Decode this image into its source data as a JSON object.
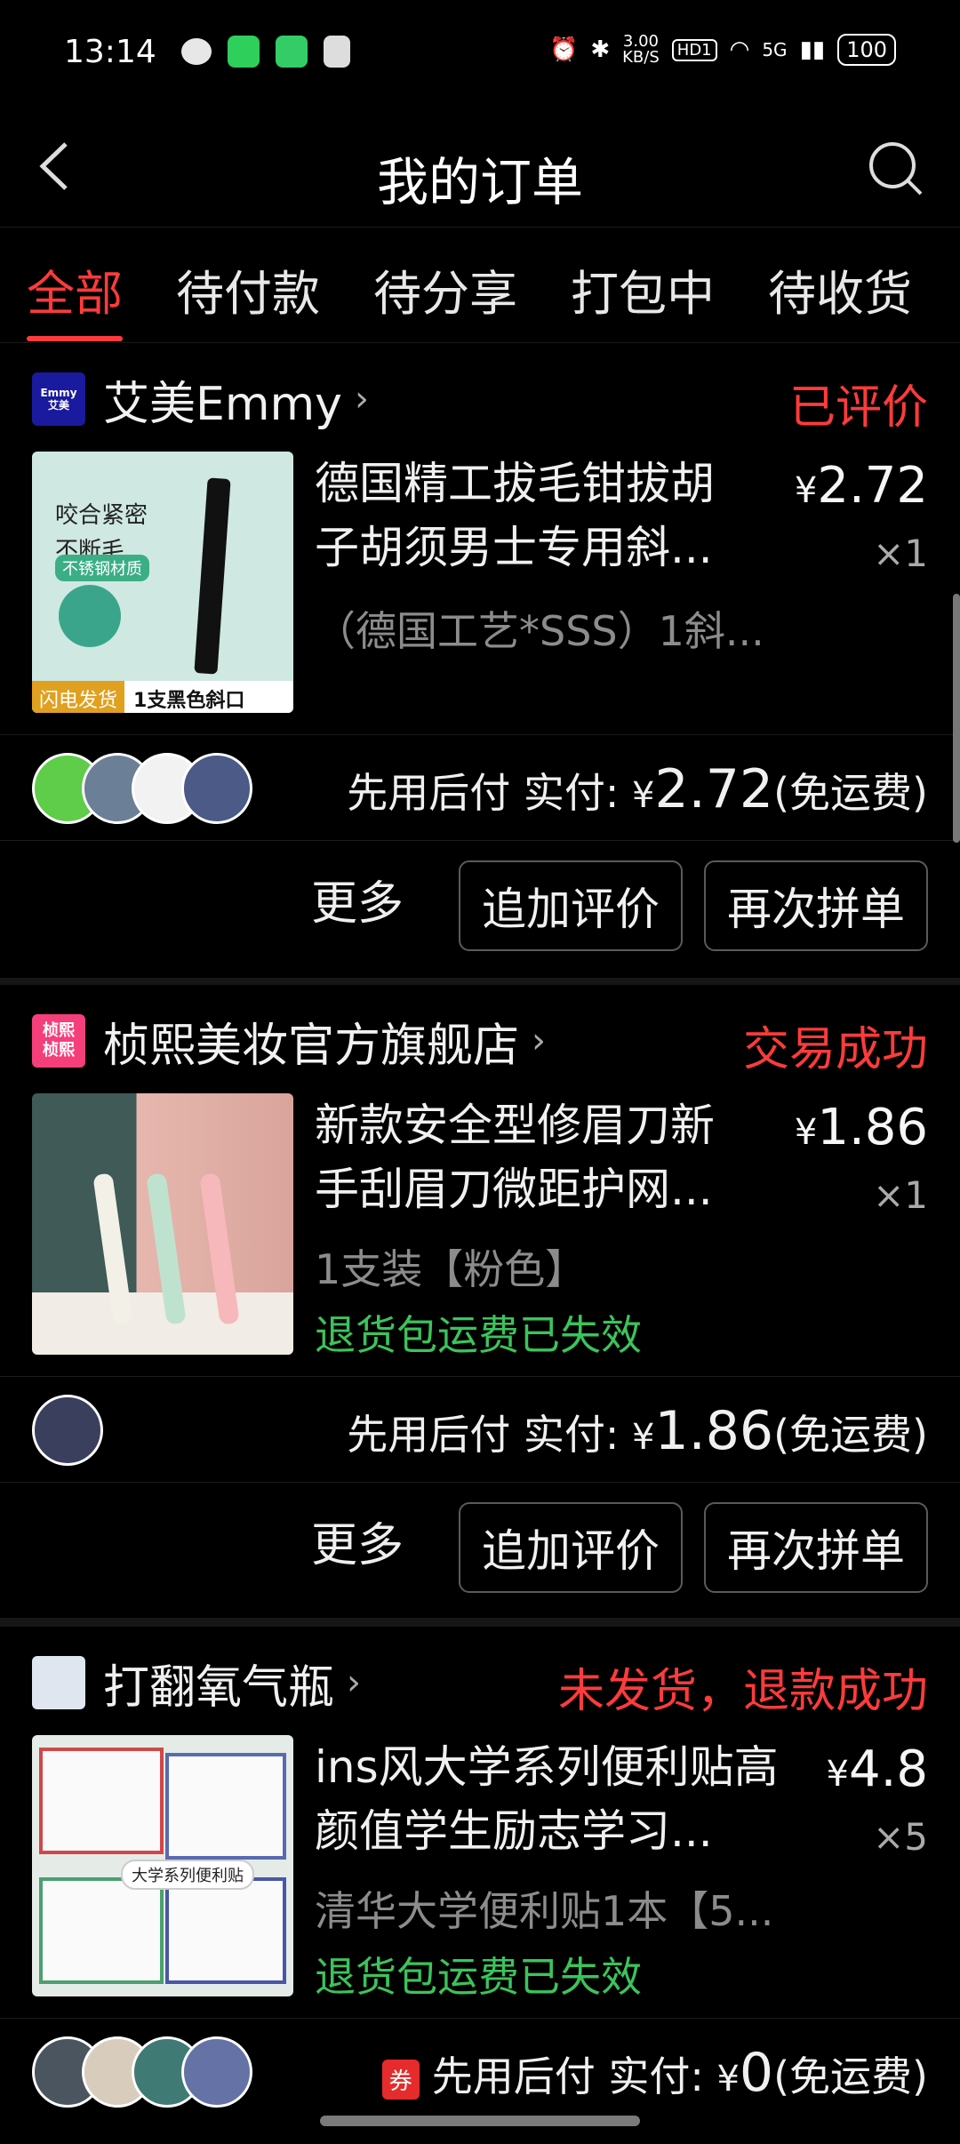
{
  "status_bar": {
    "time": "13:14",
    "speed": "3.00\nKB/S",
    "hd": "HD1",
    "network": "5G",
    "battery": "100"
  },
  "header": {
    "title": "我的订单",
    "back_icon": "back-chevron",
    "search_icon": "search"
  },
  "tabs": [
    {
      "label": "全部",
      "active": true
    },
    {
      "label": "待付款",
      "active": false
    },
    {
      "label": "待分享",
      "active": false
    },
    {
      "label": "打包中",
      "active": false
    },
    {
      "label": "待收货",
      "active": false
    }
  ],
  "orders": [
    {
      "shop_name": "艾美Emmy",
      "shop_logo_text": "Emmy\n艾美",
      "status": "已评价",
      "product_title": "德国精工拔毛钳拔胡子胡须男士专用斜...",
      "price_symbol": "¥",
      "price": "2.72",
      "qty": "×1",
      "spec": "（德国工艺*SSS）1斜...",
      "thumb_caption_1": "咬合紧密",
      "thumb_caption_2": "不断毛",
      "thumb_badge": "不锈钢材质",
      "thumb_bottom_left": "闪电发货",
      "thumb_bottom_right": "1支黑色斜口",
      "pay_prefix": "先用后付  实付: ",
      "pay_amount": "2.72",
      "pay_suffix": "(免运费)",
      "more_label": "更多",
      "btn1_label": "追加评价",
      "btn2_label": "再次拼单"
    },
    {
      "shop_name": "桢熙美妆官方旗舰店",
      "shop_logo_text": "桢熙\n桢熙",
      "status": "交易成功",
      "product_title": "新款安全型修眉刀新手刮眉刀微距护网...",
      "price_symbol": "¥",
      "price": "1.86",
      "qty": "×1",
      "spec": "1支装【粉色】",
      "note": "退货包运费已失效",
      "pay_prefix": "先用后付  实付: ",
      "pay_amount": "1.86",
      "pay_suffix": "(免运费)",
      "more_label": "更多",
      "btn1_label": "追加评价",
      "btn2_label": "再次拼单"
    },
    {
      "shop_name": "打翻氧气瓶",
      "status": "未发货，退款成功",
      "product_title": "ins风大学系列便利贴高颜值学生励志学习...",
      "price_symbol": "¥",
      "price": "4.8",
      "qty": "×5",
      "spec": "清华大学便利贴1本【5...",
      "note": "退货包运费已失效",
      "thumb_caption": "大学系列便利贴",
      "coupon_label": "券",
      "pay_prefix": "先用后付  实付: ",
      "pay_amount": "0",
      "pay_suffix": "(免运费)"
    }
  ],
  "colors": {
    "accent_red": "#ff3b3b",
    "success_green": "#3bc45a",
    "background": "#000000"
  }
}
